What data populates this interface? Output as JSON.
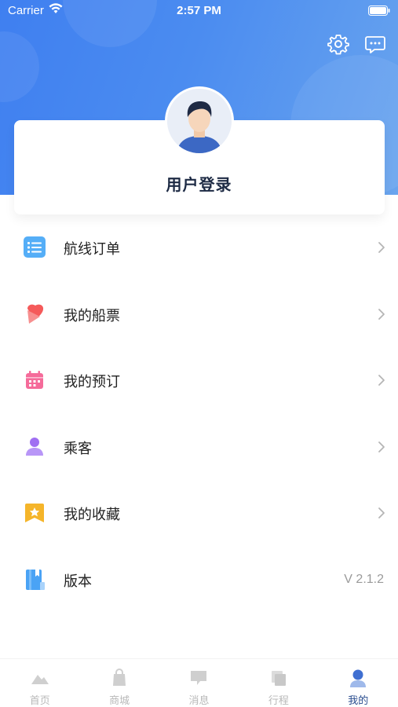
{
  "status_bar": {
    "carrier": "Carrier",
    "time": "2:57 PM"
  },
  "header": {
    "icons": [
      "gear-icon",
      "message-icon"
    ]
  },
  "profile": {
    "login_label": "用户登录",
    "avatar": "user-avatar"
  },
  "menu": {
    "items": [
      {
        "label": "航线订单",
        "icon": "list-icon",
        "color": "#4aa3f5"
      },
      {
        "label": "我的船票",
        "icon": "ticket-icon",
        "color": "#f55a5a"
      },
      {
        "label": "我的预订",
        "icon": "calendar-icon",
        "color": "#f56b9a"
      },
      {
        "label": "乘客",
        "icon": "person-icon",
        "color": "#a070f0"
      },
      {
        "label": "我的收藏",
        "icon": "star-icon",
        "color": "#f5b52a"
      },
      {
        "label": "版本",
        "icon": "book-icon",
        "color": "#4aa3f5",
        "value": "V 2.1.2"
      }
    ]
  },
  "tabbar": {
    "tabs": [
      {
        "label": "首页",
        "icon": "home-icon",
        "active": false
      },
      {
        "label": "商城",
        "icon": "shop-icon",
        "active": false
      },
      {
        "label": "消息",
        "icon": "message-tab-icon",
        "active": false
      },
      {
        "label": "行程",
        "icon": "trip-icon",
        "active": false
      },
      {
        "label": "我的",
        "icon": "profile-icon",
        "active": true
      }
    ]
  },
  "colors": {
    "header_start": "#3f7ff0",
    "header_end": "#6aa5ee",
    "active_tab": "#2a4d8f"
  }
}
